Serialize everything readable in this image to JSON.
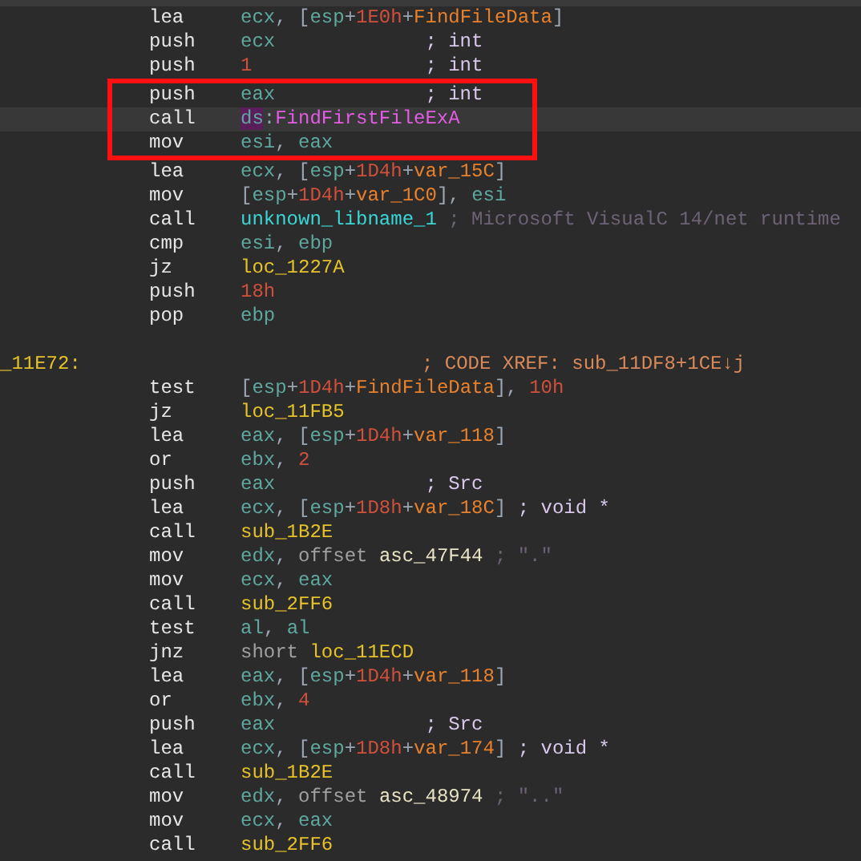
{
  "listing": [
    {
      "mn": "lea",
      "ops": [
        {
          "text": "ecx",
          "kind": "reg"
        },
        {
          "text": ", [",
          "kind": "punct"
        },
        {
          "text": "esp",
          "kind": "reg"
        },
        {
          "text": "+",
          "kind": "punct"
        },
        {
          "text": "1E0h",
          "kind": "num"
        },
        {
          "text": "+",
          "kind": "punct"
        },
        {
          "text": "FindFileData",
          "kind": "var"
        },
        {
          "text": "]",
          "kind": "punct"
        }
      ],
      "highlighted": false,
      "current": false
    },
    {
      "mn": "push",
      "ops": [
        {
          "text": "ecx",
          "kind": "reg"
        }
      ],
      "comment": {
        "text": "; int",
        "kind": "type"
      },
      "highlighted": false,
      "current": false
    },
    {
      "mn": "push",
      "ops": [
        {
          "text": "1",
          "kind": "num"
        }
      ],
      "comment": {
        "text": "; int",
        "kind": "type"
      },
      "highlighted": false,
      "current": false
    },
    {
      "mn": "push",
      "ops": [
        {
          "text": "eax",
          "kind": "reg"
        }
      ],
      "comment": {
        "text": "; int",
        "kind": "type"
      },
      "highlighted": true,
      "current": false
    },
    {
      "mn": "call",
      "ops": [
        {
          "text": "ds",
          "kind": "seg"
        },
        {
          "text": ":",
          "kind": "punct"
        },
        {
          "text": "FindFirstFileExA",
          "kind": "func"
        }
      ],
      "highlighted": true,
      "current": true
    },
    {
      "mn": "mov",
      "ops": [
        {
          "text": "esi",
          "kind": "reg"
        },
        {
          "text": ", ",
          "kind": "punct"
        },
        {
          "text": "eax",
          "kind": "reg"
        }
      ],
      "highlighted": true,
      "current": false
    },
    {
      "mn": "lea",
      "ops": [
        {
          "text": "ecx",
          "kind": "reg"
        },
        {
          "text": ", [",
          "kind": "punct"
        },
        {
          "text": "esp",
          "kind": "reg"
        },
        {
          "text": "+",
          "kind": "punct"
        },
        {
          "text": "1D4h",
          "kind": "num"
        },
        {
          "text": "+",
          "kind": "punct"
        },
        {
          "text": "var_15C",
          "kind": "var"
        },
        {
          "text": "]",
          "kind": "punct"
        }
      ],
      "highlighted": false,
      "current": false
    },
    {
      "mn": "mov",
      "ops": [
        {
          "text": "[",
          "kind": "punct"
        },
        {
          "text": "esp",
          "kind": "reg"
        },
        {
          "text": "+",
          "kind": "punct"
        },
        {
          "text": "1D4h",
          "kind": "num"
        },
        {
          "text": "+",
          "kind": "punct"
        },
        {
          "text": "var_1C0",
          "kind": "var"
        },
        {
          "text": "], ",
          "kind": "punct"
        },
        {
          "text": "esi",
          "kind": "reg"
        }
      ],
      "highlighted": false,
      "current": false
    },
    {
      "mn": "call",
      "ops": [
        {
          "text": "unknown_libname_1",
          "kind": "lib"
        }
      ],
      "comment": {
        "text": "; Microsoft VisualC 14/net runtime",
        "kind": "dim"
      },
      "highlighted": false,
      "current": false
    },
    {
      "mn": "cmp",
      "ops": [
        {
          "text": "esi",
          "kind": "reg"
        },
        {
          "text": ", ",
          "kind": "punct"
        },
        {
          "text": "ebp",
          "kind": "reg"
        }
      ],
      "highlighted": false,
      "current": false
    },
    {
      "mn": "jz",
      "ops": [
        {
          "text": "loc_1227A",
          "kind": "loc"
        }
      ],
      "highlighted": false,
      "current": false
    },
    {
      "mn": "push",
      "ops": [
        {
          "text": "18h",
          "kind": "num"
        }
      ],
      "highlighted": false,
      "current": false
    },
    {
      "mn": "pop",
      "ops": [
        {
          "text": "ebp",
          "kind": "reg"
        }
      ],
      "highlighted": false,
      "current": false
    },
    {
      "highlighted": false,
      "current": false
    },
    {
      "label": "_11E72:",
      "comment": {
        "text": "; CODE XREF: sub_11DF8+1CE↓j",
        "kind": "xref"
      },
      "highlighted": false,
      "current": false
    },
    {
      "mn": "test",
      "ops": [
        {
          "text": "[",
          "kind": "punct"
        },
        {
          "text": "esp",
          "kind": "reg"
        },
        {
          "text": "+",
          "kind": "punct"
        },
        {
          "text": "1D4h",
          "kind": "num"
        },
        {
          "text": "+",
          "kind": "punct"
        },
        {
          "text": "FindFileData",
          "kind": "var"
        },
        {
          "text": "], ",
          "kind": "punct"
        },
        {
          "text": "10h",
          "kind": "num"
        }
      ],
      "highlighted": false,
      "current": false
    },
    {
      "mn": "jz",
      "ops": [
        {
          "text": "loc_11FB5",
          "kind": "loc"
        }
      ],
      "highlighted": false,
      "current": false
    },
    {
      "mn": "lea",
      "ops": [
        {
          "text": "eax",
          "kind": "reg"
        },
        {
          "text": ", [",
          "kind": "punct"
        },
        {
          "text": "esp",
          "kind": "reg"
        },
        {
          "text": "+",
          "kind": "punct"
        },
        {
          "text": "1D4h",
          "kind": "num"
        },
        {
          "text": "+",
          "kind": "punct"
        },
        {
          "text": "var_118",
          "kind": "var"
        },
        {
          "text": "]",
          "kind": "punct"
        }
      ],
      "highlighted": false,
      "current": false
    },
    {
      "mn": "or",
      "ops": [
        {
          "text": "ebx",
          "kind": "reg"
        },
        {
          "text": ", ",
          "kind": "punct"
        },
        {
          "text": "2",
          "kind": "num"
        }
      ],
      "highlighted": false,
      "current": false
    },
    {
      "mn": "push",
      "ops": [
        {
          "text": "eax",
          "kind": "reg"
        }
      ],
      "comment": {
        "text": "; Src",
        "kind": "type"
      },
      "highlighted": false,
      "current": false
    },
    {
      "mn": "lea",
      "ops": [
        {
          "text": "ecx",
          "kind": "reg"
        },
        {
          "text": ", [",
          "kind": "punct"
        },
        {
          "text": "esp",
          "kind": "reg"
        },
        {
          "text": "+",
          "kind": "punct"
        },
        {
          "text": "1D8h",
          "kind": "num"
        },
        {
          "text": "+",
          "kind": "punct"
        },
        {
          "text": "var_18C",
          "kind": "var"
        },
        {
          "text": "]",
          "kind": "punct"
        }
      ],
      "comment": {
        "text": "; void *",
        "kind": "type"
      },
      "highlighted": false,
      "current": false
    },
    {
      "mn": "call",
      "ops": [
        {
          "text": "sub_1B2E",
          "kind": "loc"
        }
      ],
      "highlighted": false,
      "current": false
    },
    {
      "mn": "mov",
      "ops": [
        {
          "text": "edx",
          "kind": "reg"
        },
        {
          "text": ", ",
          "kind": "punct"
        },
        {
          "text": "offset ",
          "kind": "kw"
        },
        {
          "text": "asc_47F44",
          "kind": "data"
        }
      ],
      "comment": {
        "text": "; \".\"",
        "kind": "dim"
      },
      "highlighted": false,
      "current": false
    },
    {
      "mn": "mov",
      "ops": [
        {
          "text": "ecx",
          "kind": "reg"
        },
        {
          "text": ", ",
          "kind": "punct"
        },
        {
          "text": "eax",
          "kind": "reg"
        }
      ],
      "highlighted": false,
      "current": false
    },
    {
      "mn": "call",
      "ops": [
        {
          "text": "sub_2FF6",
          "kind": "loc"
        }
      ],
      "highlighted": false,
      "current": false
    },
    {
      "mn": "test",
      "ops": [
        {
          "text": "al",
          "kind": "reg"
        },
        {
          "text": ", ",
          "kind": "punct"
        },
        {
          "text": "al",
          "kind": "reg"
        }
      ],
      "highlighted": false,
      "current": false
    },
    {
      "mn": "jnz",
      "ops": [
        {
          "text": "short ",
          "kind": "kw"
        },
        {
          "text": "loc_11ECD",
          "kind": "loc"
        }
      ],
      "highlighted": false,
      "current": false
    },
    {
      "mn": "lea",
      "ops": [
        {
          "text": "eax",
          "kind": "reg"
        },
        {
          "text": ", [",
          "kind": "punct"
        },
        {
          "text": "esp",
          "kind": "reg"
        },
        {
          "text": "+",
          "kind": "punct"
        },
        {
          "text": "1D4h",
          "kind": "num"
        },
        {
          "text": "+",
          "kind": "punct"
        },
        {
          "text": "var_118",
          "kind": "var"
        },
        {
          "text": "]",
          "kind": "punct"
        }
      ],
      "highlighted": false,
      "current": false
    },
    {
      "mn": "or",
      "ops": [
        {
          "text": "ebx",
          "kind": "reg"
        },
        {
          "text": ", ",
          "kind": "punct"
        },
        {
          "text": "4",
          "kind": "num"
        }
      ],
      "highlighted": false,
      "current": false
    },
    {
      "mn": "push",
      "ops": [
        {
          "text": "eax",
          "kind": "reg"
        }
      ],
      "comment": {
        "text": "; Src",
        "kind": "type"
      },
      "highlighted": false,
      "current": false
    },
    {
      "mn": "lea",
      "ops": [
        {
          "text": "ecx",
          "kind": "reg"
        },
        {
          "text": ", [",
          "kind": "punct"
        },
        {
          "text": "esp",
          "kind": "reg"
        },
        {
          "text": "+",
          "kind": "punct"
        },
        {
          "text": "1D8h",
          "kind": "num"
        },
        {
          "text": "+",
          "kind": "punct"
        },
        {
          "text": "var_174",
          "kind": "var"
        },
        {
          "text": "]",
          "kind": "punct"
        }
      ],
      "comment": {
        "text": "; void *",
        "kind": "type"
      },
      "highlighted": false,
      "current": false
    },
    {
      "mn": "call",
      "ops": [
        {
          "text": "sub_1B2E",
          "kind": "loc"
        }
      ],
      "highlighted": false,
      "current": false
    },
    {
      "mn": "mov",
      "ops": [
        {
          "text": "edx",
          "kind": "reg"
        },
        {
          "text": ", ",
          "kind": "punct"
        },
        {
          "text": "offset ",
          "kind": "kw"
        },
        {
          "text": "asc_48974",
          "kind": "data"
        }
      ],
      "comment": {
        "text": "; \"..\"",
        "kind": "dim"
      },
      "highlighted": false,
      "current": false
    },
    {
      "mn": "mov",
      "ops": [
        {
          "text": "ecx",
          "kind": "reg"
        },
        {
          "text": ", ",
          "kind": "punct"
        },
        {
          "text": "eax",
          "kind": "reg"
        }
      ],
      "highlighted": false,
      "current": false
    },
    {
      "mn": "call",
      "ops": [
        {
          "text": "sub_2FF6",
          "kind": "loc"
        }
      ],
      "highlighted": false,
      "current": false
    }
  ]
}
